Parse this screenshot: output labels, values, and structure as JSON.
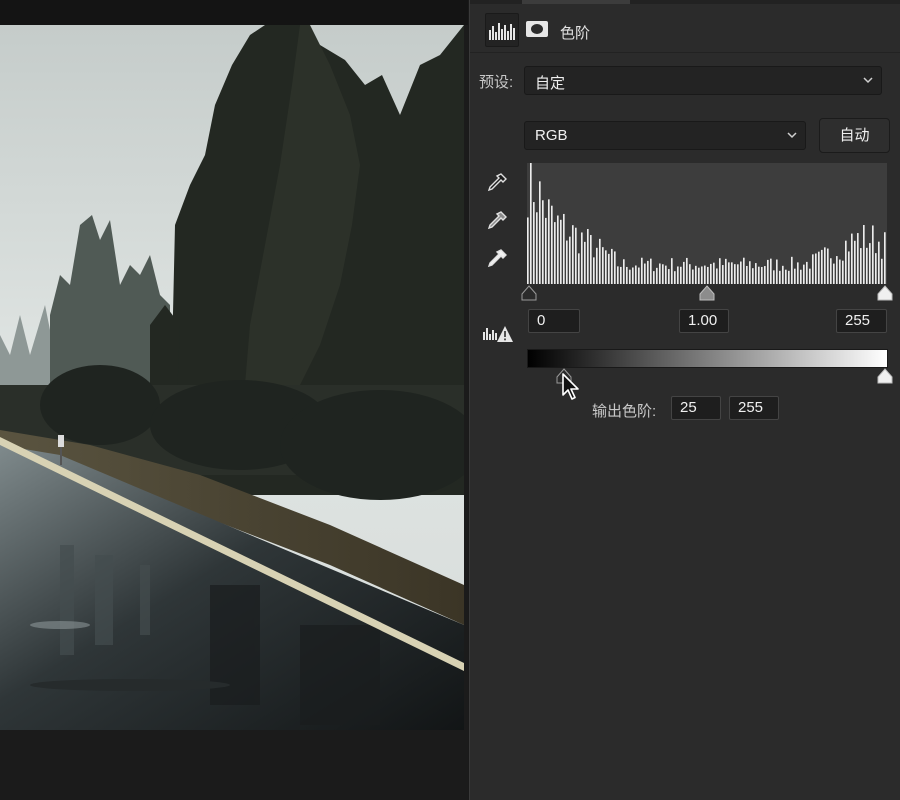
{
  "panel": {
    "title": "色阶",
    "tabs": [
      "histogram-icon",
      "layer-mask-icon"
    ]
  },
  "preset": {
    "label": "预设:",
    "value": "自定"
  },
  "channel": {
    "value": "RGB"
  },
  "auto_button_label": "自动",
  "eyedroppers": [
    "eyedropper-black-icon",
    "eyedropper-gray-icon",
    "eyedropper-white-icon"
  ],
  "input_levels": {
    "black": "0",
    "gamma": "1.00",
    "white": "255"
  },
  "output_levels": {
    "label": "输出色阶:",
    "black": "25",
    "white": "255"
  },
  "colors": {
    "panel_bg": "#2b2b2b",
    "histogram_bg": "#3d3d3d",
    "histogram_bars": "#ececec",
    "field_bg": "#1e1e1e"
  }
}
